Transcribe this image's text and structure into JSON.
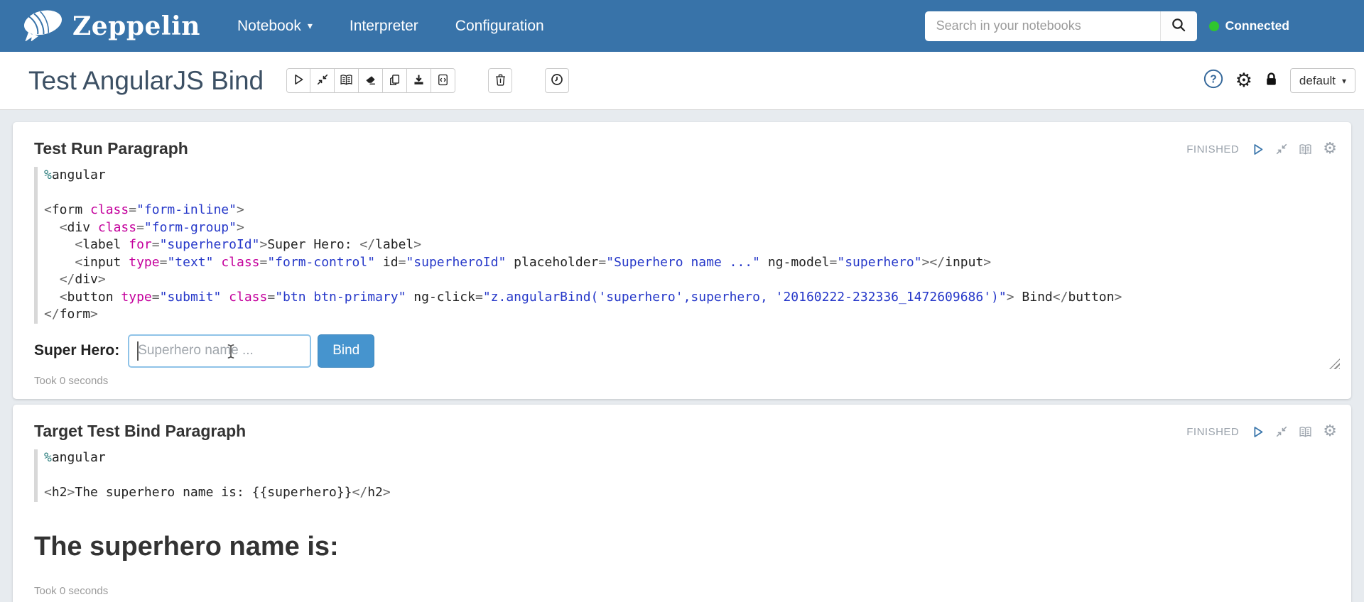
{
  "navbar": {
    "brand": "Zeppelin",
    "nav_items": [
      {
        "label": "Notebook",
        "caret": "▾"
      },
      {
        "label": "Interpreter"
      },
      {
        "label": "Configuration"
      }
    ],
    "search": {
      "placeholder": "Search in your notebooks"
    },
    "status": {
      "label": "Connected"
    }
  },
  "note": {
    "title": "Test AngularJS Bind",
    "toolbar_icons": [
      "run-all-paragraphs",
      "collapse-expand",
      "show-hide-code-output",
      "clear-output",
      "clone-note",
      "export-note",
      "commit-note",
      "remove-note",
      "run-scheduler"
    ],
    "header_right_icons": [
      "help",
      "note-settings",
      "lock",
      "interpreter-binding"
    ],
    "interpreter_label": "default",
    "interpreter_caret": "▾"
  },
  "paragraphs": [
    {
      "title": "Test Run Paragraph",
      "status": "FINISHED",
      "took": "Took 0 seconds",
      "control_icons": [
        "run",
        "collapse",
        "show-hide-output",
        "settings"
      ],
      "code_tokens": [
        [
          {
            "t": "%",
            "c": "pct"
          },
          {
            "t": "angular",
            "c": "plain"
          }
        ],
        [],
        [
          {
            "t": "<",
            "c": "punct"
          },
          {
            "t": "form",
            "c": "plain"
          },
          {
            "t": " ",
            "c": "plain"
          },
          {
            "t": "class",
            "c": "attr"
          },
          {
            "t": "=",
            "c": "punct"
          },
          {
            "t": "\"form-inline\"",
            "c": "str"
          },
          {
            "t": ">",
            "c": "punct"
          }
        ],
        [
          {
            "t": "  ",
            "c": "plain"
          },
          {
            "t": "<",
            "c": "punct"
          },
          {
            "t": "div",
            "c": "plain"
          },
          {
            "t": " ",
            "c": "plain"
          },
          {
            "t": "class",
            "c": "attr"
          },
          {
            "t": "=",
            "c": "punct"
          },
          {
            "t": "\"form-group\"",
            "c": "str"
          },
          {
            "t": ">",
            "c": "punct"
          }
        ],
        [
          {
            "t": "    ",
            "c": "plain"
          },
          {
            "t": "<",
            "c": "punct"
          },
          {
            "t": "label",
            "c": "plain"
          },
          {
            "t": " ",
            "c": "plain"
          },
          {
            "t": "for",
            "c": "attr"
          },
          {
            "t": "=",
            "c": "punct"
          },
          {
            "t": "\"superheroId\"",
            "c": "str"
          },
          {
            "t": ">",
            "c": "punct"
          },
          {
            "t": "Super Hero: ",
            "c": "plain"
          },
          {
            "t": "</",
            "c": "punct"
          },
          {
            "t": "label",
            "c": "plain"
          },
          {
            "t": ">",
            "c": "punct"
          }
        ],
        [
          {
            "t": "    ",
            "c": "plain"
          },
          {
            "t": "<",
            "c": "punct"
          },
          {
            "t": "input",
            "c": "plain"
          },
          {
            "t": " ",
            "c": "plain"
          },
          {
            "t": "type",
            "c": "attr"
          },
          {
            "t": "=",
            "c": "punct"
          },
          {
            "t": "\"text\"",
            "c": "str"
          },
          {
            "t": " ",
            "c": "plain"
          },
          {
            "t": "class",
            "c": "attr"
          },
          {
            "t": "=",
            "c": "punct"
          },
          {
            "t": "\"form-control\"",
            "c": "str"
          },
          {
            "t": " ",
            "c": "plain"
          },
          {
            "t": "id",
            "c": "plain"
          },
          {
            "t": "=",
            "c": "punct"
          },
          {
            "t": "\"superheroId\"",
            "c": "str"
          },
          {
            "t": " ",
            "c": "plain"
          },
          {
            "t": "placeholder",
            "c": "plain"
          },
          {
            "t": "=",
            "c": "punct"
          },
          {
            "t": "\"Superhero name ...\"",
            "c": "str"
          },
          {
            "t": " ",
            "c": "plain"
          },
          {
            "t": "ng-model",
            "c": "plain"
          },
          {
            "t": "=",
            "c": "punct"
          },
          {
            "t": "\"superhero\"",
            "c": "str"
          },
          {
            "t": "></",
            "c": "punct"
          },
          {
            "t": "input",
            "c": "plain"
          },
          {
            "t": ">",
            "c": "punct"
          }
        ],
        [
          {
            "t": "  ",
            "c": "plain"
          },
          {
            "t": "</",
            "c": "punct"
          },
          {
            "t": "div",
            "c": "plain"
          },
          {
            "t": ">",
            "c": "punct"
          }
        ],
        [
          {
            "t": "  ",
            "c": "plain"
          },
          {
            "t": "<",
            "c": "punct"
          },
          {
            "t": "button",
            "c": "plain"
          },
          {
            "t": " ",
            "c": "plain"
          },
          {
            "t": "type",
            "c": "attr"
          },
          {
            "t": "=",
            "c": "punct"
          },
          {
            "t": "\"submit\"",
            "c": "str"
          },
          {
            "t": " ",
            "c": "plain"
          },
          {
            "t": "class",
            "c": "attr"
          },
          {
            "t": "=",
            "c": "punct"
          },
          {
            "t": "\"btn btn-primary\"",
            "c": "str"
          },
          {
            "t": " ",
            "c": "plain"
          },
          {
            "t": "ng-click",
            "c": "plain"
          },
          {
            "t": "=",
            "c": "punct"
          },
          {
            "t": "\"z.angularBind('superhero',superhero, '20160222-232336_1472609686')\"",
            "c": "str"
          },
          {
            "t": ">",
            "c": "punct"
          },
          {
            "t": " Bind",
            "c": "plain"
          },
          {
            "t": "</",
            "c": "punct"
          },
          {
            "t": "button",
            "c": "plain"
          },
          {
            "t": ">",
            "c": "punct"
          }
        ],
        [
          {
            "t": "</",
            "c": "punct"
          },
          {
            "t": "form",
            "c": "plain"
          },
          {
            "t": ">",
            "c": "punct"
          }
        ]
      ],
      "form": {
        "label": "Super Hero:",
        "input_value": "",
        "input_placeholder": "Superhero name ...",
        "button_label": "Bind"
      }
    },
    {
      "title": "Target Test Bind Paragraph",
      "status": "FINISHED",
      "took": "Took 0 seconds",
      "control_icons": [
        "run",
        "collapse",
        "show-hide-output",
        "settings"
      ],
      "code_tokens": [
        [
          {
            "t": "%",
            "c": "pct"
          },
          {
            "t": "angular",
            "c": "plain"
          }
        ],
        [],
        [
          {
            "t": "<",
            "c": "punct"
          },
          {
            "t": "h2",
            "c": "plain"
          },
          {
            "t": ">",
            "c": "punct"
          },
          {
            "t": "The superhero name is: {{superhero}}",
            "c": "plain"
          },
          {
            "t": "</",
            "c": "punct"
          },
          {
            "t": "h2",
            "c": "plain"
          },
          {
            "t": ">",
            "c": "punct"
          }
        ]
      ],
      "output_heading": "The superhero name is:"
    }
  ],
  "colors": {
    "navbar_bg": "#3873a9",
    "connected_green": "#2fc52f",
    "primary_button": "#4694ce",
    "input_focus_border": "#8fc3e8",
    "status_gray": "#9aa2ab",
    "code_attr": "#c4009c",
    "code_string": "#2638c9",
    "note_title": "#3c5064"
  }
}
